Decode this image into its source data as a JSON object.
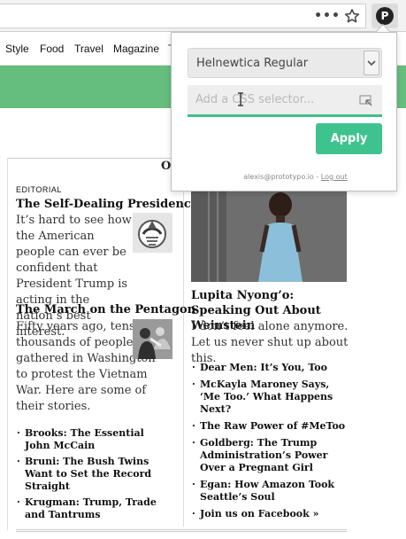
{
  "browser": {
    "menu_icon": "more-dots-icon",
    "bookmark_icon": "star-outline-icon",
    "extension_icon": "prototypo-logo-icon",
    "extension_glyph": "P"
  },
  "nav": {
    "items": [
      "Style",
      "Food",
      "Travel",
      "Magazine",
      "T"
    ]
  },
  "colors": {
    "green_band": "#65bd7e",
    "accent": "#3fc38e",
    "input_underline": "#3fbf88"
  },
  "page": {
    "section_heading": "O",
    "editorial": {
      "kicker": "EDITORIAL",
      "headline": "The Self-Dealing Presidency",
      "summary": "It’s hard to see how the American people can ever be confident that President Trump is acting in the nation’s best interest."
    },
    "pentagon": {
      "headline": "The March on the Pentagon",
      "summary": "Fifty years ago, tens of thousands of people gathered in Washington to protest the Vietnam War. Here are some of their stories."
    },
    "left_links": [
      "Brooks: The Essential John McCain",
      "Bruni: The Bush Twins Want to Set the Record Straight",
      "Krugman: Trump, Trade and Tantrums"
    ],
    "feature": {
      "headline": "Lupita Nyong’o: Speaking Out About Weinstein",
      "summary": "I don’t feel alone anymore. Let us never shut up about this."
    },
    "right_links": [
      "Dear Men: It’s You, Too",
      "McKayla Maroney Says, ‘Me Too.’ What Happens Next?",
      "The Raw Power of #MeToo",
      "Goldberg: The Trump Administration’s Power Over a Pregnant Girl",
      "Egan: How Amazon Took Seattle’s Soul",
      "Join us on Facebook »"
    ]
  },
  "popup": {
    "font_select_value": "Helnewtica Regular",
    "selector_placeholder": "Add a CSS selector...",
    "apply_label": "Apply",
    "account_email": "alexis@prototypo.io",
    "separator": " - ",
    "logout_label": "Log out"
  }
}
